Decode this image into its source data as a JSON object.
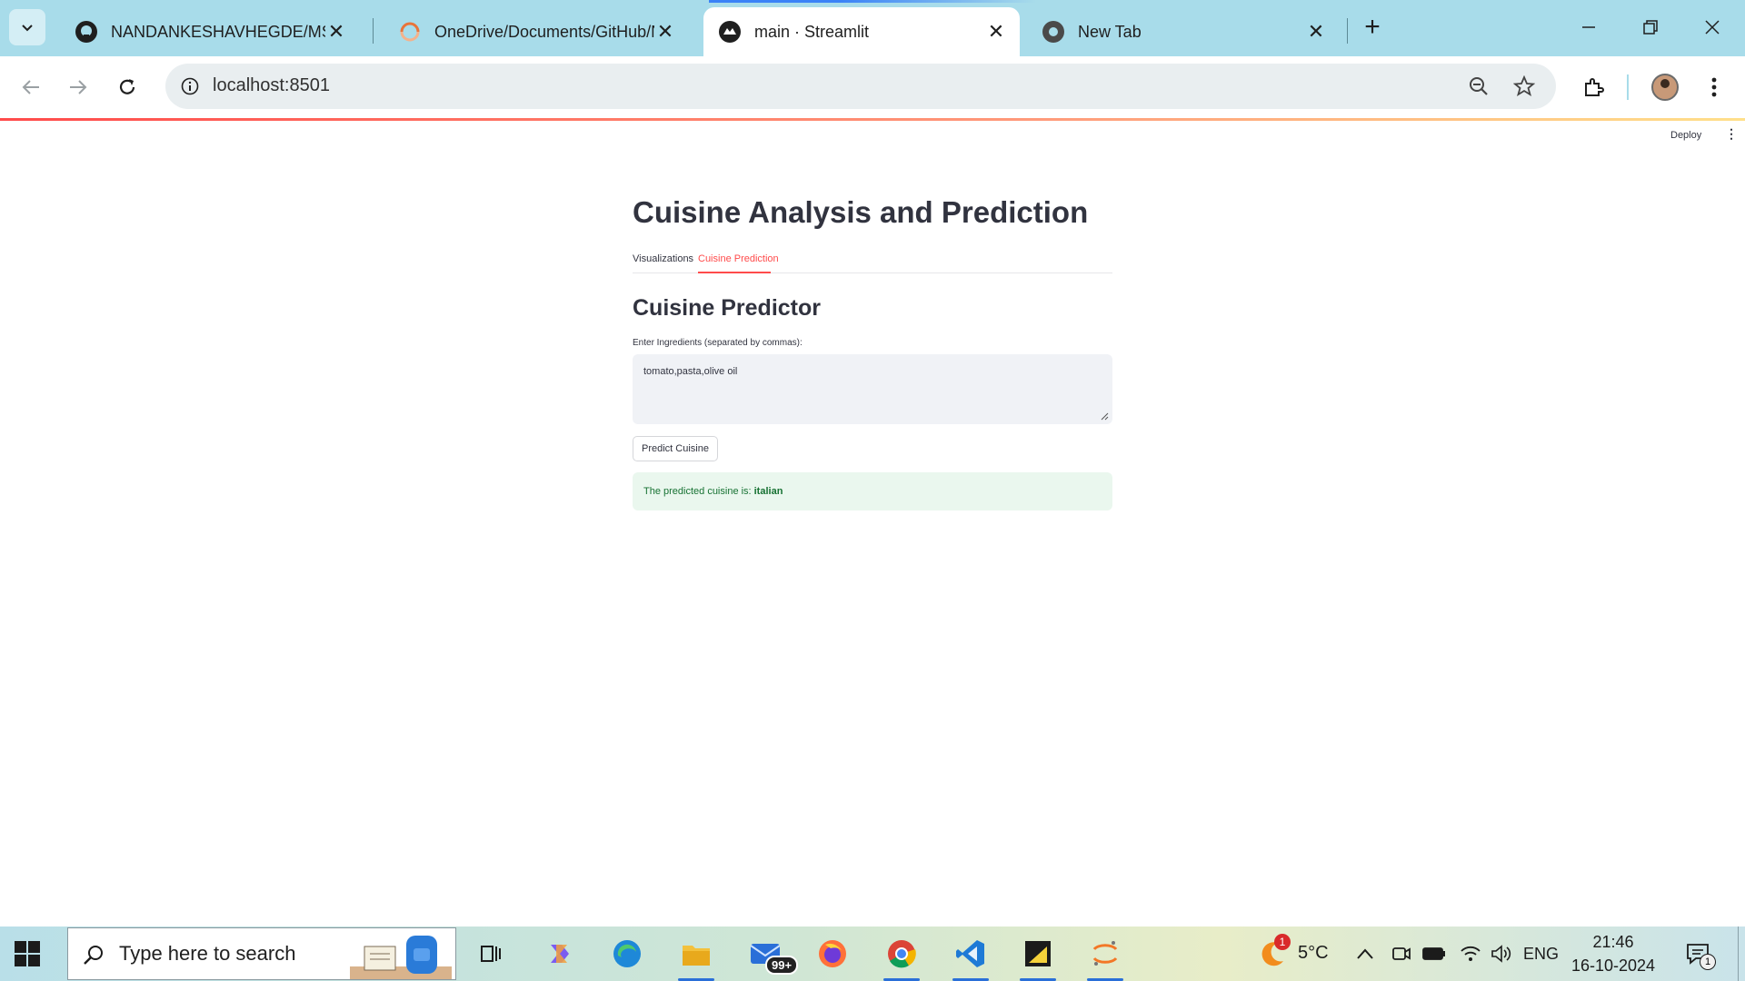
{
  "browser": {
    "tabs": [
      {
        "title": "NANDANKESHAVHEGDE/MSU_",
        "icon": "github-icon"
      },
      {
        "title": "OneDrive/Documents/GitHub/N",
        "icon": "loading-icon"
      },
      {
        "title": "main · Streamlit",
        "icon": "streamlit-icon",
        "active": true
      },
      {
        "title": "New Tab",
        "icon": "chrome-icon"
      }
    ],
    "url": "localhost:8501"
  },
  "streamlit": {
    "deploy_label": "Deploy",
    "menu_label": "⋮"
  },
  "app": {
    "title": "Cuisine Analysis and Prediction",
    "tabs": [
      {
        "label": "Visualizations",
        "active": false
      },
      {
        "label": "Cuisine Prediction",
        "active": true
      }
    ],
    "subheader": "Cuisine Predictor",
    "input_label": "Enter Ingredients (separated by commas):",
    "input_value": "tomato,pasta,olive oil",
    "button_label": "Predict Cuisine",
    "result_prefix": "The predicted cuisine is:",
    "result_value": "italian"
  },
  "taskbar": {
    "search_placeholder": "Type here to search",
    "mail_badge": "99+",
    "weather_badge": "1",
    "temperature": "5°C",
    "language": "ENG",
    "time": "21:46",
    "date": "16-10-2024",
    "notification_count": "1"
  },
  "colors": {
    "accent": "#ff4b4b",
    "success_bg": "#eaf7ee",
    "success_text": "#177233",
    "tabstrip": "#a8dcea"
  }
}
